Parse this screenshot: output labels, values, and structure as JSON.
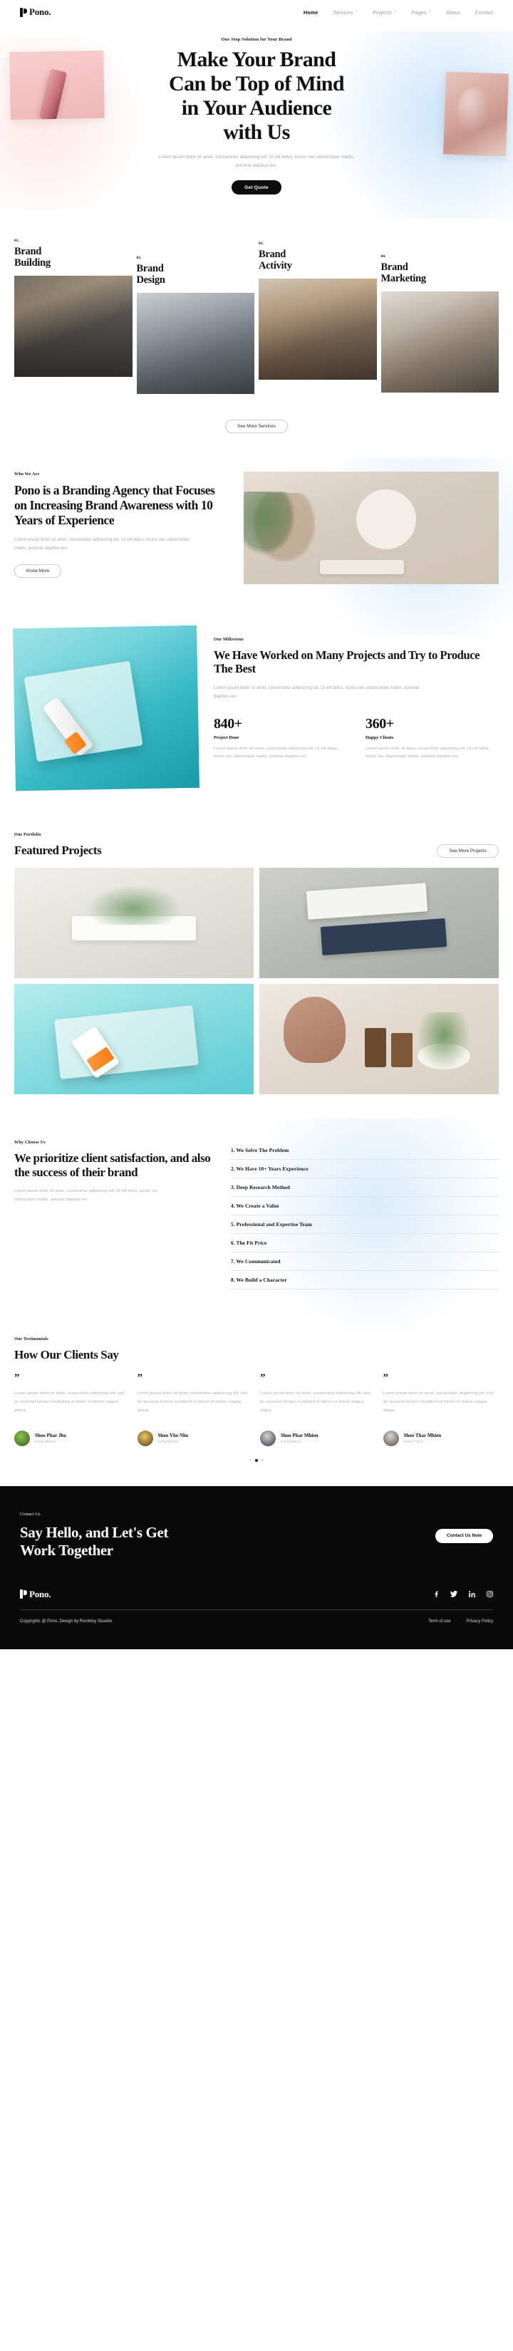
{
  "brand": {
    "name": "Pono."
  },
  "nav": {
    "items": [
      {
        "label": "Home",
        "active": true,
        "caret": false
      },
      {
        "label": "Services",
        "active": false,
        "caret": true
      },
      {
        "label": "Projects",
        "active": false,
        "caret": true
      },
      {
        "label": "Pages",
        "active": false,
        "caret": true
      },
      {
        "label": "About",
        "active": false,
        "caret": false
      },
      {
        "label": "Contact",
        "active": false,
        "caret": false
      }
    ]
  },
  "hero": {
    "eyebrow": "One Stop Solution for Your Brand",
    "title_line1": "Make Your Brand",
    "title_line2": "Can be Top of Mind",
    "title_line3": "in Your Audience",
    "title_line4": "with Us",
    "subtitle": "Lorem ipsum dolor sit amet, consectetur adipiscing elit. Ut elit tellus, luctus nec ullamcorper mattis, pulvinar dapibus leo.",
    "cta": "Get Quote"
  },
  "services": {
    "items": [
      {
        "num": "01.",
        "title_l1": "Brand",
        "title_l2": "Building"
      },
      {
        "num": "02.",
        "title_l1": "Brand",
        "title_l2": "Design"
      },
      {
        "num": "03.",
        "title_l1": "Brand",
        "title_l2": "Activity"
      },
      {
        "num": "04.",
        "title_l1": "Brand",
        "title_l2": "Marketing"
      }
    ],
    "cta": "See More Services"
  },
  "who": {
    "label": "Who We Are",
    "heading": "Pono is a Branding Agency that Focuses on Increasing Brand Awareness with 10 Years of Experience",
    "text": "Lorem ipsum dolor sit amet, consectetur adipiscing elit. Ut elit tellus, luctus nec ullamcorper mattis, pulvinar dapibus leo.",
    "cta": "Know More"
  },
  "milestone": {
    "label": "Our Millestone",
    "heading": "We Have Worked on Many Projects and Try to Produce The Best",
    "text": "Lorem ipsum dolor sit amet, consectetur adipiscing elit. Ut elit tellus, luctus nec ullamcorper mattis, pulvinar dapibus leo.",
    "stats": [
      {
        "number": "840+",
        "label": "Project Done",
        "desc": "Lorem ipsum dolor sit amet, consectetur adipiscing elit. Ut elit tellus, luctus nec ullamcorper mattis, pulvinar dapibus leo."
      },
      {
        "number": "360+",
        "label": "Happy Clients",
        "desc": "Lorem ipsum dolor sit amet, consectetur adipiscing elit. Ut elit tellus, luctus nec ullamcorper mattis, pulvinar dapibus leo."
      }
    ]
  },
  "portfolio": {
    "label": "Our Portfolio",
    "title": "Featured Projects",
    "cta": "See More Projects"
  },
  "why": {
    "label": "Why Choose Us",
    "heading": "We prioritize client satisfaction, and also the success of their brand",
    "text": "Lorem ipsum dolor sit amet, consectetur adipiscing elit. Ut elit tellus, luctus nec ullamcorper mattis, pulvinar dapibus leo.",
    "items": [
      "1. We Solve The Problem",
      "2. We Have 10+ Years Experience",
      "3. Deep Research Method",
      "4. We Create a Value",
      "5. Professional and Expertise Team",
      "6. The Fit Price",
      "7. We Communicated",
      "8. We Build a Character"
    ]
  },
  "testimonials": {
    "label": "Our Testimonials",
    "title": "How Our Clients Say",
    "quote_glyph": "”",
    "items": [
      {
        "text": "Lorem ipsum dolor sit amet, consectetur adipiscing elit, sed do eiusmod tempor incididunt ut labore et dolore magna aliqua.",
        "name": "Shoo Phar Jho",
        "role": "Kang Makan"
      },
      {
        "text": "Lorem ipsum dolor sit amet, consectetur adipiscing elit, sed do eiusmod tempor incididunt ut labore et dolore magna aliqua.",
        "name": "Shoo Yho Nho",
        "role": "Kang Masak"
      },
      {
        "text": "Lorem ipsum dolor sit amet, consectetur adipiscing elit, sed do eiusmod tempor incididunt ut labore et dolore magna aliqua.",
        "name": "Shoo Phar Mhien",
        "role": "Kang Bakso"
      },
      {
        "text": "Lorem ipsum dolor sit amet, consectetur adipiscing elit, sed do eiusmod tempor incididunt ut labore et dolore magna aliqua.",
        "name": "Shoo Thar Mhien",
        "role": "Kang Parkir"
      }
    ]
  },
  "contact": {
    "label": "Contact Us",
    "heading_l1": "Say Hello, and Let's Get",
    "heading_l2": "Work Together",
    "cta": "Contact Us Now"
  },
  "footer": {
    "brand": "Pono.",
    "copyright": "Copyrights @ Pono, Design by Rockboy Stuudio",
    "legal": [
      "Term of use",
      "Privacy Policy"
    ],
    "socials": [
      "facebook-icon",
      "twitter-icon",
      "linkedin-icon",
      "instagram-icon"
    ]
  },
  "colors": {
    "ink": "#111111",
    "muted": "#a9a9a9",
    "dark_bg": "#0a0a0a",
    "accent_blue": "#cbe3f7",
    "accent_pink": "#f3c2c1"
  }
}
